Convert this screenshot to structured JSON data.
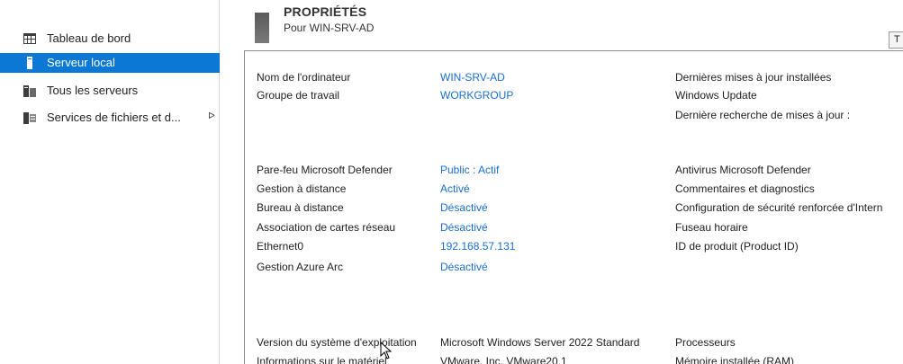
{
  "sidebar": {
    "items": [
      {
        "label": "Tableau de bord",
        "icon": "dashboard-icon"
      },
      {
        "label": "Serveur local",
        "icon": "server-icon"
      },
      {
        "label": "Tous les serveurs",
        "icon": "servers-icon"
      },
      {
        "label": "Services de fichiers et d...",
        "icon": "file-services-icon",
        "has_submenu": true
      }
    ],
    "selected_index": 1,
    "submenu_arrow": "ᐅ"
  },
  "header": {
    "title": "PROPRIÉTÉS",
    "subtitle": "Pour WIN-SRV-AD",
    "task_button": "T"
  },
  "properties": {
    "group1": [
      {
        "label": "Nom de l'ordinateur",
        "value": "WIN-SRV-AD",
        "link": true
      },
      {
        "label": "Groupe de travail",
        "value": "WORKGROUP",
        "link": true
      }
    ],
    "group1_right": [
      "Dernières mises à jour installées",
      "Windows Update",
      "Dernière recherche de mises à jour :"
    ],
    "group2": [
      {
        "label": "Pare-feu Microsoft Defender",
        "value": "Public : Actif",
        "link": true
      },
      {
        "label": "Gestion à distance",
        "value": "Activé",
        "link": true
      },
      {
        "label": "Bureau à distance",
        "value": "Désactivé",
        "link": true
      },
      {
        "label": "Association de cartes réseau",
        "value": "Désactivé",
        "link": true
      },
      {
        "label": "Ethernet0",
        "value": "192.168.57.131",
        "link": true
      },
      {
        "label": "Gestion Azure Arc",
        "value": "Désactivé",
        "link": true
      }
    ],
    "group2_right": [
      "Antivirus Microsoft Defender",
      "Commentaires et diagnostics",
      "Configuration de sécurité renforcée d'Intern",
      "Fuseau horaire",
      "ID de produit (Product ID)"
    ],
    "group3": [
      {
        "label": "Version du système d'exploitation",
        "value": "Microsoft Windows Server 2022 Standard",
        "link": false
      },
      {
        "label": "Informations sur le matériel",
        "value": "VMware, Inc. VMware20,1",
        "link": false
      }
    ],
    "group3_right": [
      "Processeurs",
      "Mémoire installée (RAM)"
    ]
  },
  "colors": {
    "selected_bg": "#0a78d4",
    "link": "#1a6dcf"
  }
}
